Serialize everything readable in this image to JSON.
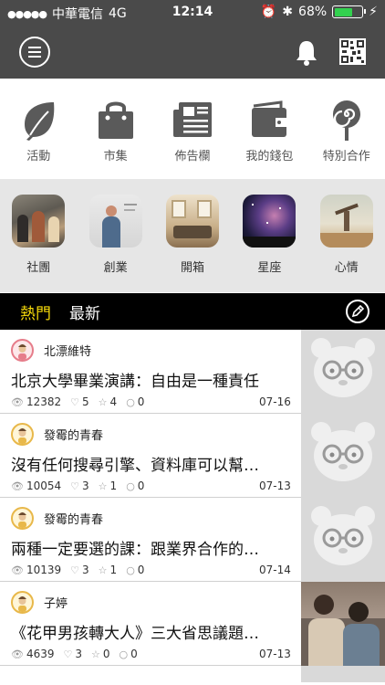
{
  "status_bar": {
    "carrier": "中華電信",
    "network": "4G",
    "time": "12:14",
    "battery": "68%",
    "battery_level": 0.68
  },
  "icons": {
    "menu": "menu-icon",
    "notifications": "bell-icon",
    "qr": "qr-code-icon",
    "edit": "pencil-icon"
  },
  "categories": [
    {
      "label": "活動",
      "icon": "leaf-icon"
    },
    {
      "label": "市集",
      "icon": "shopping-bag-icon"
    },
    {
      "label": "佈告欄",
      "icon": "newspaper-icon"
    },
    {
      "label": "我的錢包",
      "icon": "wallet-icon"
    },
    {
      "label": "特別合作",
      "icon": "lollipop-icon"
    }
  ],
  "topics": [
    {
      "label": "社團"
    },
    {
      "label": "創業"
    },
    {
      "label": "開箱"
    },
    {
      "label": "星座"
    },
    {
      "label": "心情"
    }
  ],
  "tabs": {
    "hot": "熱門",
    "latest": "最新"
  },
  "colors": {
    "header_bg": "#4a4a4a",
    "active_tab": "#f5d90a",
    "battery": "#33d14f",
    "topic_strip_bg": "#e6e6e6"
  },
  "posts": [
    {
      "author": "北漂維特",
      "title": "北京大學畢業演講：自由是一種責任",
      "views": "12382",
      "likes": "5",
      "stars": "4",
      "comments": "0",
      "date": "07-16"
    },
    {
      "author": "發霉的青春",
      "title": "沒有任何搜尋引擎、資料庫可以幫…",
      "views": "10054",
      "likes": "3",
      "stars": "1",
      "comments": "0",
      "date": "07-13"
    },
    {
      "author": "發霉的青春",
      "title": "兩種一定要選的課：跟業界合作的…",
      "views": "10139",
      "likes": "3",
      "stars": "1",
      "comments": "0",
      "date": "07-14"
    },
    {
      "author": "子婷",
      "title": "《花甲男孩轉大人》三大省思議題…",
      "views": "4639",
      "likes": "3",
      "stars": "0",
      "comments": "0",
      "date": "07-13"
    }
  ]
}
